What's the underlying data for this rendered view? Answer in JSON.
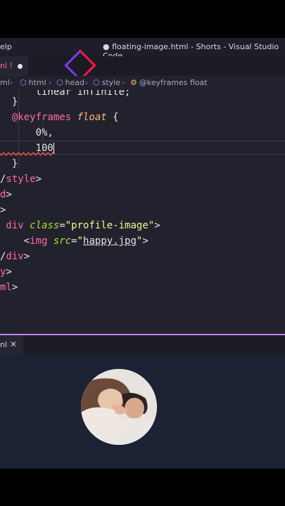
{
  "window": {
    "menu_fragment": "elp",
    "title": "● floating-image.html - Shorts - Visual Studio Code"
  },
  "tab": {
    "label": "nl !",
    "modified": true
  },
  "breadcrumb": [
    {
      "text": "ml",
      "icon": ""
    },
    {
      "text": "html",
      "icon": "cube-icon"
    },
    {
      "text": "head",
      "icon": "cube-icon"
    },
    {
      "text": "style",
      "icon": "cube-icon"
    },
    {
      "text": "@keyframes float",
      "icon": "symbol-icon"
    }
  ],
  "editor": {
    "lines": [
      {
        "parts": [
          [
            "punc",
            "      linear infinite;"
          ]
        ]
      },
      {
        "parts": [
          [
            "punc",
            "  }"
          ]
        ]
      },
      {
        "parts": [
          [
            "kw",
            "  @keyframes "
          ],
          [
            "fn",
            "float"
          ],
          [
            "punc",
            " {"
          ]
        ]
      },
      {
        "parts": [
          [
            "punc",
            "      0%,"
          ]
        ]
      },
      {
        "parts": [
          [
            "squig",
            "      100"
          ]
        ],
        "cursor": true
      },
      {
        "parts": [
          [
            "punc",
            "  }"
          ]
        ]
      },
      {
        "parts": [
          [
            "punc",
            "/"
          ],
          [
            "tag",
            "style"
          ],
          [
            "punc",
            ">"
          ]
        ]
      },
      {
        "parts": [
          [
            "tag",
            "d"
          ],
          [
            "punc",
            ">"
          ]
        ]
      },
      {
        "parts": [
          [
            "punc",
            ">"
          ]
        ]
      },
      {
        "parts": [
          [
            "tag",
            " div "
          ],
          [
            "attr",
            "class"
          ],
          [
            "punc",
            "="
          ],
          [
            "str",
            "\"profile-image\""
          ],
          [
            "punc",
            ">"
          ]
        ]
      },
      {
        "parts": [
          [
            "punc",
            "    <"
          ],
          [
            "tag",
            "img "
          ],
          [
            "attr",
            "src"
          ],
          [
            "punc",
            "="
          ],
          [
            "str",
            "\""
          ],
          [
            "und",
            "happy.jpg"
          ],
          [
            "str",
            "\""
          ],
          [
            "punc",
            ">"
          ]
        ]
      },
      {
        "parts": [
          [
            "punc",
            "/"
          ],
          [
            "tag",
            "div"
          ],
          [
            "punc",
            ">"
          ]
        ]
      },
      {
        "parts": [
          [
            "tag",
            "y"
          ],
          [
            "punc",
            ">"
          ]
        ]
      },
      {
        "parts": [
          [
            "tag",
            "ml"
          ],
          [
            "punc",
            ">"
          ]
        ]
      }
    ]
  },
  "panel": {
    "tab_label": "nl",
    "close_icon": "close-icon"
  },
  "preview": {
    "image": "profile-image"
  }
}
